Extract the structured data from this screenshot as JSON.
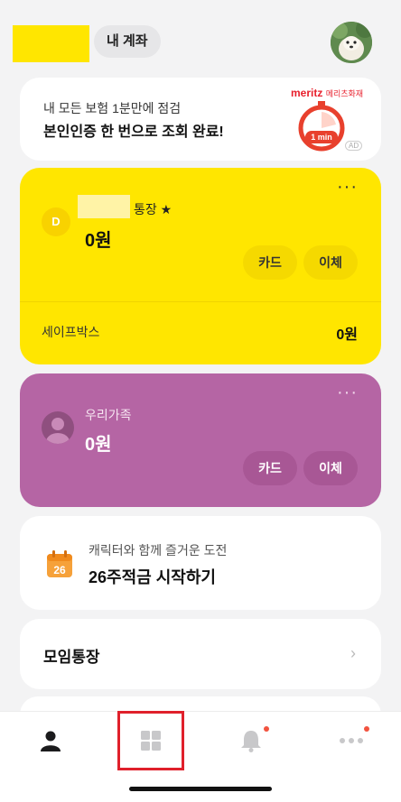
{
  "header": {
    "my_account_label": "내 계좌"
  },
  "ad": {
    "line1": "내 모든 보험 1분만에 점검",
    "line2": "본인인증 한 번으로 조회 완료!",
    "brand": "meritz",
    "brand_sub": "메리츠화재",
    "clock_text": "1 min",
    "badge": "AD"
  },
  "main_account": {
    "icon_letter": "D",
    "name_suffix": "통장 ★",
    "balance": "0원",
    "card_button": "카드",
    "transfer_button": "이체",
    "safebox_label": "세이프박스",
    "safebox_value": "0원",
    "more": "···"
  },
  "family_account": {
    "name": "우리가족",
    "balance": "0원",
    "card_button": "카드",
    "transfer_button": "이체",
    "more": "···"
  },
  "challenge": {
    "calendar_number": "26",
    "line1": "캐릭터와 함께 즐거운 도전",
    "line2": "26주적금 시작하기"
  },
  "group": {
    "label": "모임통장",
    "chevron": "›"
  },
  "bottom_nav": {
    "items": [
      {
        "icon": "person-icon"
      },
      {
        "icon": "grid-icon"
      },
      {
        "icon": "bell-icon"
      },
      {
        "icon": "more-icon"
      }
    ],
    "accent": "#e0202b"
  },
  "colors": {
    "brand_yellow": "#ffe600",
    "family_purple": "#b565a4",
    "notification_dot": "#f2533f"
  }
}
